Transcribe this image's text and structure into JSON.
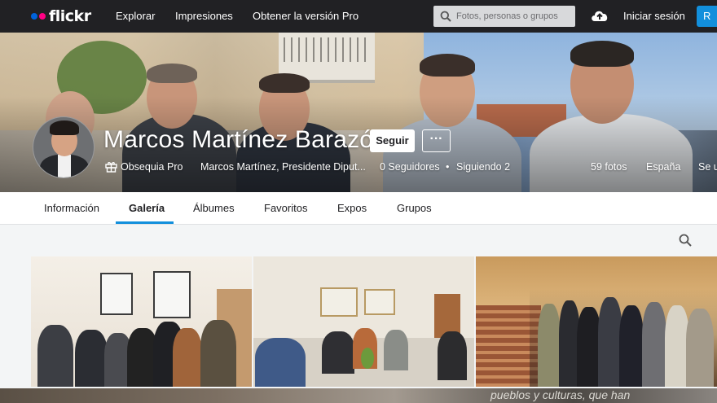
{
  "nav": {
    "logo": "flickr",
    "links": [
      "Explorar",
      "Impresiones",
      "Obtener la versión Pro"
    ],
    "search_placeholder": "Fotos, personas o grupos",
    "signin": "Iniciar sesión",
    "register": "R"
  },
  "profile": {
    "name": "Marcos Martínez Barazón",
    "follow_label": "Seguir",
    "more_label": "···",
    "pro": "Obsequia Pro",
    "description": "Marcos Martínez, Presidente Diput...",
    "followers": "0 Seguidores",
    "separator": "•",
    "following": "Siguiendo 2",
    "photos": "59 fotos",
    "country": "España",
    "extra": "Se u"
  },
  "tabs": [
    "Información",
    "Galería",
    "Álbumes",
    "Favoritos",
    "Expos",
    "Grupos"
  ],
  "active_tab": "Galería",
  "strip_text": "pueblos y culturas, que han",
  "colors": {
    "accent": "#128fdc",
    "nav_bg": "#212124",
    "brand_blue": "#0063dc",
    "brand_pink": "#ff0084"
  }
}
